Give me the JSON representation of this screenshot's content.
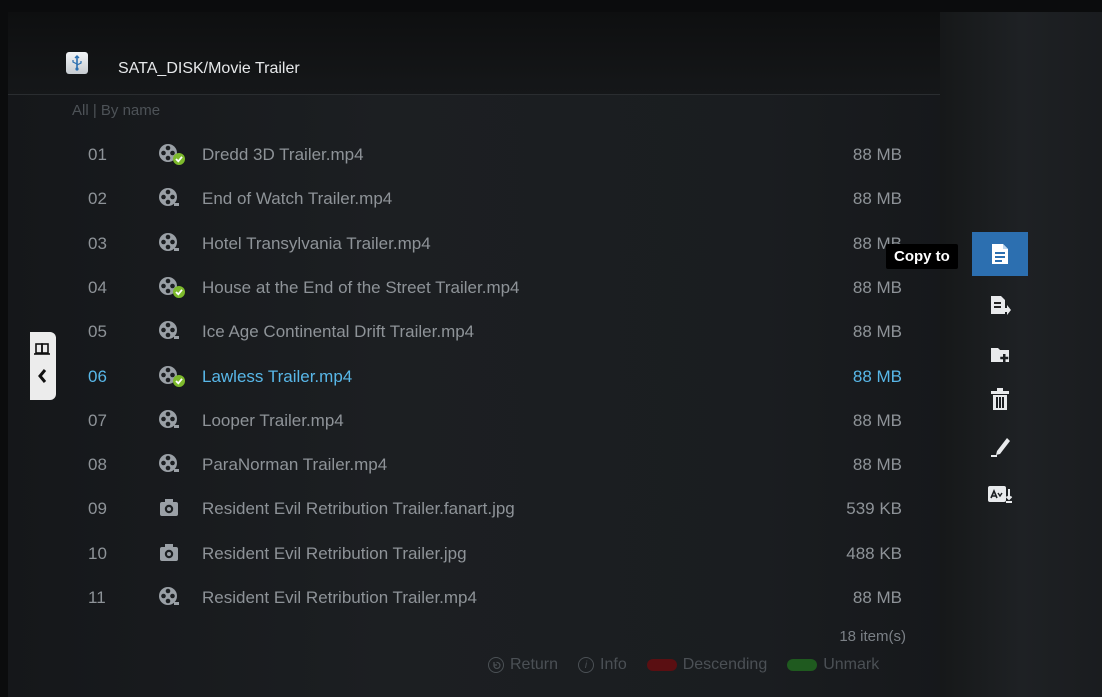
{
  "header": {
    "path": "SATA_DISK/Movie Trailer"
  },
  "sort_label": "All | By name",
  "files": [
    {
      "num": "01",
      "name": "Dredd 3D Trailer.mp4",
      "size": "88 MB",
      "type": "video",
      "checked": true
    },
    {
      "num": "02",
      "name": "End of Watch Trailer.mp4",
      "size": "88 MB",
      "type": "video",
      "checked": false
    },
    {
      "num": "03",
      "name": "Hotel Transylvania Trailer.mp4",
      "size": "88 MB",
      "type": "video",
      "checked": false
    },
    {
      "num": "04",
      "name": "House at the End of the Street Trailer.mp4",
      "size": "88 MB",
      "type": "video",
      "checked": true
    },
    {
      "num": "05",
      "name": "Ice Age Continental Drift Trailer.mp4",
      "size": "88 MB",
      "type": "video",
      "checked": false
    },
    {
      "num": "06",
      "name": "Lawless Trailer.mp4",
      "size": "88 MB",
      "type": "video",
      "checked": true,
      "selected": true
    },
    {
      "num": "07",
      "name": "Looper Trailer.mp4",
      "size": "88 MB",
      "type": "video",
      "checked": false
    },
    {
      "num": "08",
      "name": "ParaNorman Trailer.mp4",
      "size": "88 MB",
      "type": "video",
      "checked": false
    },
    {
      "num": "09",
      "name": "Resident Evil Retribution Trailer.fanart.jpg",
      "size": "539 KB",
      "type": "photo",
      "checked": false
    },
    {
      "num": "10",
      "name": "Resident Evil Retribution Trailer.jpg",
      "size": "488 KB",
      "type": "photo",
      "checked": false
    },
    {
      "num": "11",
      "name": "Resident Evil Retribution Trailer.mp4",
      "size": "88 MB",
      "type": "video",
      "checked": false
    }
  ],
  "footer": {
    "count": "18 item(s)",
    "return_label": "Return",
    "info_label": "Info",
    "descending_label": "Descending",
    "unmark_label": "Unmark",
    "red_key_color": "#5a0f12",
    "green_key_color": "#1f5a1f"
  },
  "tooltip": "Copy to",
  "menu": [
    {
      "icon": "copy-icon",
      "active": true
    },
    {
      "icon": "move-icon",
      "active": false
    },
    {
      "icon": "new-folder-icon",
      "active": false
    },
    {
      "icon": "delete-icon",
      "active": false
    },
    {
      "icon": "rename-icon",
      "active": false
    },
    {
      "icon": "sort-icon",
      "active": false
    }
  ],
  "colors": {
    "selected_text": "#58b7e8",
    "accent": "#2c6fb0"
  }
}
